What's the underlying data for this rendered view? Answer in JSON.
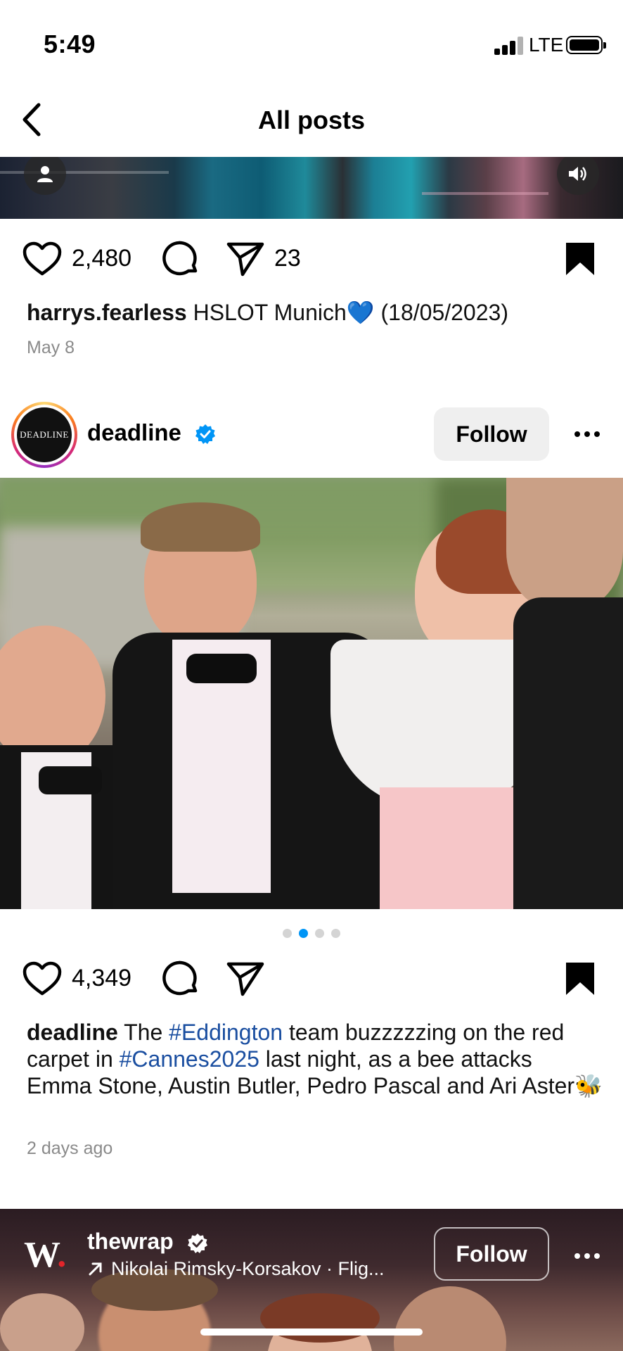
{
  "status_bar": {
    "time": "5:49",
    "network": "LTE"
  },
  "nav": {
    "title": "All posts"
  },
  "post1": {
    "likes": "2,480",
    "shares": "23",
    "username": "harrys.fearless",
    "caption": "HSLOT Munich💙 (18/05/2023)",
    "date": "May 8"
  },
  "post2": {
    "avatar_text": "DEADLINE",
    "username": "deadline",
    "follow_label": "Follow",
    "likes": "4,349",
    "caption_username": "deadline",
    "caption_parts": [
      "The ",
      "#Eddington",
      " team buzzzzzing on the red carpet in ",
      "#Cannes2025",
      " last night, as a bee attacks Emma Stone, Austin Butler, Pedro Pascal and Ari Aster🐝"
    ],
    "date": "2 days ago",
    "carousel": {
      "count": 4,
      "active": 2
    }
  },
  "post3": {
    "logo": "W",
    "username": "thewrap",
    "audio": "Nikolai Rimsky-Korsakov · Flig...",
    "follow_label": "Follow"
  },
  "colors": {
    "link": "#1a4ea0",
    "verified": "#0095f6",
    "muted": "#8a8a8a"
  }
}
